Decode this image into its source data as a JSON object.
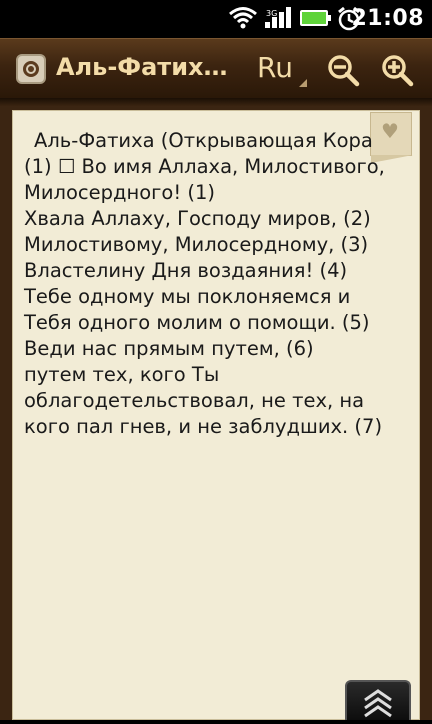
{
  "status_bar": {
    "time": "21:08"
  },
  "header": {
    "title": "Аль-Фатих…",
    "language": "Ru"
  },
  "content": {
    "lines": [
      "Аль-Фатиха (Открывающая Кора",
      "(1) ☐ Во имя Аллаха, Милостивого,",
      "Милосердного! (1)",
      "Хвала Аллаху, Господу миров, (2)",
      "Милостивому, Милосердному, (3)",
      "Властелину Дня воздаяния! (4)",
      "Тебе одному мы поклоняемся и",
      "Тебя одного молим о помощи. (5)",
      "Веди нас прямым путем, (6)",
      "путем тех, кого Ты",
      "облагодетельствовал, не тех, на",
      "кого пал гнев, и не заблудших. (7)"
    ]
  },
  "colors": {
    "title_text": "#f3dca8",
    "page_bg": "#f2ecd6",
    "frame": "#3b2512",
    "battery": "#5fd33a"
  }
}
